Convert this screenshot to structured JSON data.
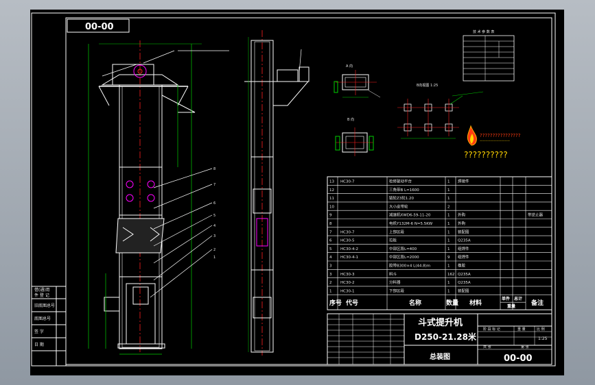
{
  "colors": {
    "paper": "#000000",
    "line": "#ffffff",
    "center": "#ff2020",
    "dim": "#00d000",
    "accent": "#ff00ff",
    "leader": "#ffffff",
    "note": "#ffff00"
  },
  "drawing_code": "00-00",
  "view_titles": {
    "side_a": "A 向",
    "side_b": "B 向",
    "plan": "B向视图 1:25"
  },
  "tech_table_title": "技 术 参 数 表",
  "logo_icon": "flame-logo-icon",
  "logo_text": "??????????",
  "logo_sub": "????????????????",
  "left_titleblock": [
    "借(通)用",
    "件 登 记",
    "旧底图总号",
    "底图总号",
    "签  字",
    "日  期"
  ],
  "bom_rows": [
    {
      "no": "13",
      "code": "HC30-7",
      "name": "检修驱动平台",
      "qty": "1",
      "mat": "焊接件",
      "note": ""
    },
    {
      "no": "12",
      "code": "",
      "name": "三角带B L=1600",
      "qty": "1",
      "mat": "",
      "note": ""
    },
    {
      "no": "11",
      "code": "",
      "name": "链轮Z3轮1.20",
      "qty": "1",
      "mat": "",
      "note": ""
    },
    {
      "no": "10",
      "code": "",
      "name": "大小皮带轮",
      "qty": "2",
      "mat": "",
      "note": ""
    },
    {
      "no": "9",
      "code": "",
      "name": "减速机XWD6-59-11-20",
      "qty": "1",
      "mat": "外购",
      "note": "带逆止器"
    },
    {
      "no": "8",
      "code": "",
      "name": "电机Y132M-6 N=5.5KW",
      "qty": "1",
      "mat": "外购",
      "note": ""
    },
    {
      "no": "7",
      "code": "HC30-7",
      "name": "上部区段",
      "qty": "1",
      "mat": "装配图",
      "note": ""
    },
    {
      "no": "6",
      "code": "HC30-5",
      "name": "拉板",
      "qty": "1",
      "mat": "Q235A",
      "note": ""
    },
    {
      "no": "5",
      "code": "HC30-4-2",
      "name": "中部区段L=400",
      "qty": "1",
      "mat": "组焊件",
      "note": ""
    },
    {
      "no": "4",
      "code": "HC30-4-1",
      "name": "中部区段L=2000",
      "qty": "9",
      "mat": "组焊件",
      "note": ""
    },
    {
      "no": "3",
      "code": "",
      "name": "胶带B300×4 L(44.8)m",
      "qty": "1",
      "mat": "橡胶",
      "note": ""
    },
    {
      "no": "3",
      "code": "HC30-3",
      "name": "料斗",
      "qty": "162",
      "mat": "Q235A",
      "note": ""
    },
    {
      "no": "2",
      "code": "HC30-2",
      "name": "分料器",
      "qty": "1",
      "mat": "Q235A",
      "note": ""
    },
    {
      "no": "1",
      "code": "HC30-1",
      "name": "下部区段",
      "qty": "1",
      "mat": "装配图",
      "note": ""
    }
  ],
  "bom_header": {
    "no": "序号",
    "code": "代号",
    "name": "名称",
    "qty": "数量",
    "mat": "材料",
    "unit_weight": "单件",
    "total_weight": "总计",
    "weight": "重量",
    "note": "备注"
  },
  "title_block": {
    "machine": "斗式提升机",
    "model": "D250-21.28米",
    "sheet_name": "总装图",
    "code": "00-00",
    "scale": "1:25",
    "stage_label": "阶 段 标 记",
    "weight_label": "重 量",
    "ratio_label": "比 例",
    "sheet_label": "共   张",
    "sheet_of": "第   张"
  },
  "part_callouts": [
    "8",
    "7",
    "6",
    "5",
    "4",
    "3",
    "2",
    "1"
  ]
}
